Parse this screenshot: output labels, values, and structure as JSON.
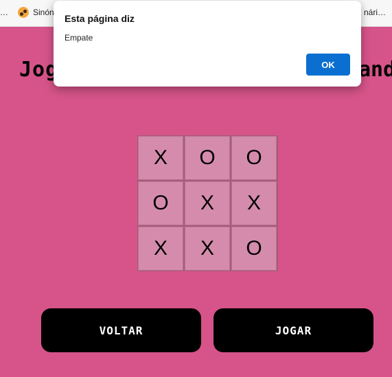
{
  "browser": {
    "bookmarks": {
      "left_ellipsis": "…",
      "site_label": "Sinón",
      "right_fragment": "nári…",
      "site_icon": "bookmark-favicon-icon"
    }
  },
  "page": {
    "title_left": "Jog",
    "title_right": "and",
    "board": [
      [
        "X",
        "O",
        "O"
      ],
      [
        "O",
        "X",
        "X"
      ],
      [
        "X",
        "X",
        "O"
      ]
    ],
    "buttons": {
      "back_label": "VOLTAR",
      "play_label": "JOGAR"
    },
    "colors": {
      "background": "#d6548a",
      "cell": "#d58cac",
      "button": "#000000",
      "ok_button": "#0a6fd0"
    }
  },
  "dialog": {
    "title": "Esta página diz",
    "message": "Empate",
    "ok_label": "OK"
  }
}
